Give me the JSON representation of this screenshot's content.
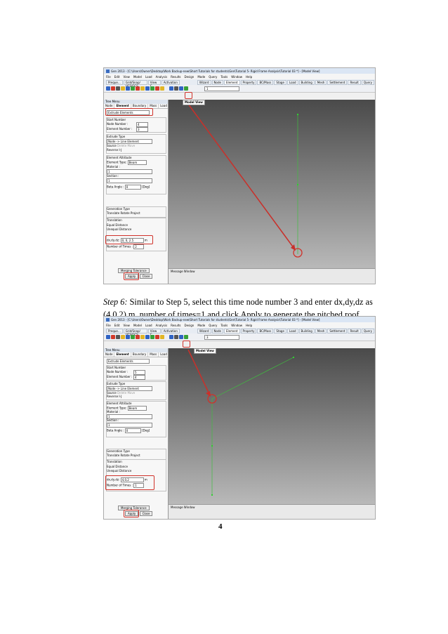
{
  "title_bar": "Gen 2013 - [C:\\Users\\Owner\\Desktop\\Work Backup-new\\Short Tutorials for students\\Gen\\Tutorial 5- Rigid Frame Analysis\\Tutorial 03 *] - [Model View]",
  "menu": [
    "File",
    "Edit",
    "View",
    "Model",
    "Load",
    "Analysis",
    "Results",
    "Design",
    "Mode",
    "Query",
    "Tools",
    "Window",
    "Help"
  ],
  "toolbar_tabs": [
    "Preque...",
    "Grid/Snap/ UCS/GCS",
    "View C...",
    "Activation",
    "Wizard",
    "Node",
    "Element",
    "Property",
    "BC/Mass",
    "Stage",
    "Load",
    "Building",
    "Mesh",
    "Settlement",
    "Result",
    "Query"
  ],
  "tree_menu": {
    "title": "Tree Menu",
    "tabs": [
      "Node",
      "Element",
      "Boundary",
      "Mass",
      "Load"
    ],
    "function": "Extrude Elements",
    "group_start_number": "Start Number",
    "node_number_label": "Node Number :",
    "element_number_label": "Element Number :",
    "group_extrude_type": "Extrude Type",
    "extrude_type": "Node -> Line Element",
    "source_label": "Source",
    "delete_label": "Delete",
    "move_label": "Move",
    "reverse_label": "Reverse I-J",
    "group_element_attribute": "Element Attribute",
    "element_type_label": "Element Type:",
    "element_type_value": "Beam",
    "material_label": "Material :",
    "material_value": "1",
    "section_label": "Section :",
    "section_value": "1",
    "beta_angle_label": "Beta Angle :",
    "beta_angle_value": "0",
    "beta_angle_unit": "[Deg]",
    "group_generation_type": "Generation Type",
    "translate_label": "Translate",
    "rotate_label": "Rotate",
    "project_label": "Project",
    "group_translation": "Translation",
    "equal_distance_label": "Equal Distance",
    "unequal_distance_label": "Unequal Distance",
    "dxdydz_label": "dx,dy,dz:",
    "unit_label": "m",
    "number_of_times_label": "Number of Times :",
    "merging_tolerance": "Merging Tolerance",
    "apply_label": "Apply",
    "close_label": "Close"
  },
  "screenshots": [
    {
      "node_number": "4",
      "element_number": "3",
      "dxdydz": "0, 0, 2.5",
      "number_of_times": "2",
      "selection_value": "1",
      "view_tab": "Model View",
      "message_window": "Message Window"
    },
    {
      "node_number": "5",
      "element_number": "4",
      "dxdydz": "4,0,2",
      "number_of_times": "1",
      "selection_value": "3",
      "view_tab": "Model View",
      "message_window": "Message Window"
    }
  ],
  "step_label": "Step 6:",
  "caption": " Similar to Step 5, select this time node number 3 and enter dx,dy,dz as (4,0,2) m, number of times=1 and click Apply to generate the pitched roof.",
  "page_number": "4",
  "colors": {
    "highlight": "#d0322a",
    "model_line": "#3fbf3f",
    "node_marker": "#2ed12e"
  }
}
